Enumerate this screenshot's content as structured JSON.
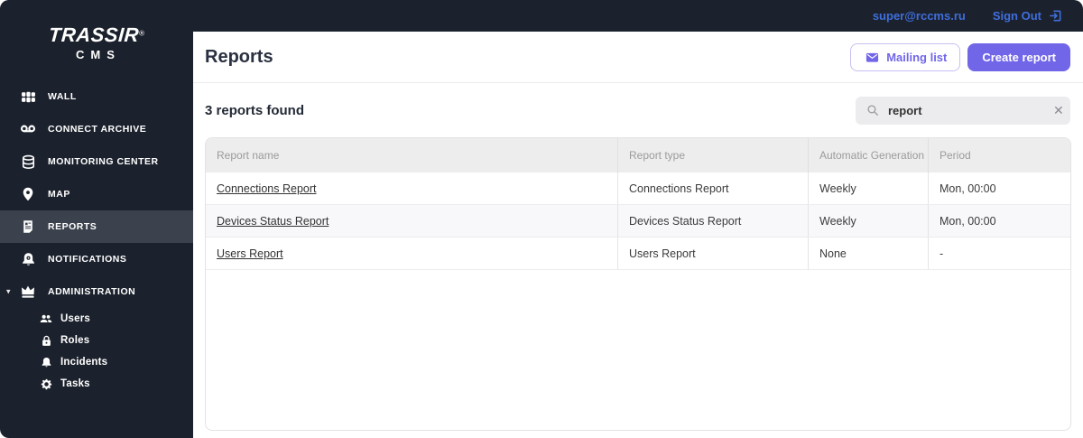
{
  "topbar": {
    "email": "super@rccms.ru",
    "sign_out_label": "Sign Out"
  },
  "sidebar": {
    "logo": {
      "brand": "TRASSIR",
      "registered": "®",
      "sub": "CMS"
    },
    "items": [
      {
        "label": "WALL"
      },
      {
        "label": "CONNECT ARCHIVE"
      },
      {
        "label": "MONITORING CENTER"
      },
      {
        "label": "MAP"
      },
      {
        "label": "REPORTS",
        "active": true
      },
      {
        "label": "NOTIFICATIONS"
      },
      {
        "label": "ADMINISTRATION",
        "expanded": true
      }
    ],
    "admin_children": [
      {
        "label": "Users"
      },
      {
        "label": "Roles"
      },
      {
        "label": "Incidents"
      },
      {
        "label": "Tasks"
      }
    ]
  },
  "header": {
    "title": "Reports",
    "mailing_list_button": "Mailing list",
    "create_report_button": "Create report"
  },
  "toolbar": {
    "results_count": "3 reports found",
    "search_value": "report",
    "clear_label": "✕"
  },
  "table": {
    "columns": [
      "Report name",
      "Report type",
      "Automatic Generation",
      "Period"
    ],
    "rows": [
      {
        "name": "Connections Report",
        "type": "Connections Report",
        "auto": "Weekly",
        "period": "Mon, 00:00"
      },
      {
        "name": "Devices Status Report",
        "type": "Devices Status Report",
        "auto": "Weekly",
        "period": "Mon, 00:00"
      },
      {
        "name": "Users Report",
        "type": "Users Report",
        "auto": "None",
        "period": "-"
      }
    ]
  },
  "colors": {
    "sidebar_dark": "#1c222d",
    "sidebar_active": "#3b414d",
    "link_blue": "#3f6edc",
    "accent_purple": "#7166e8"
  }
}
